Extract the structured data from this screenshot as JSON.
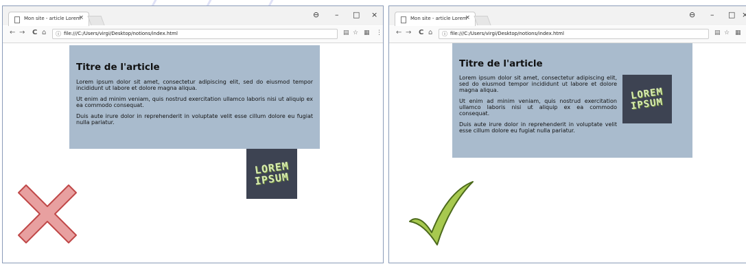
{
  "left_window": {
    "tab_title": "Mon site - article Lorem",
    "url": "file:///C:/Users/virgi/Desktop/notions/index.html",
    "article": {
      "title": "Titre de l'article",
      "paragraphs": [
        "Lorem ipsum dolor sit amet, consectetur adipiscing elit, sed do eiusmod tempor incididunt ut labore et dolore magna aliqua.",
        "Ut enim ad minim veniam, quis nostrud exercitation ullamco laboris nisi ut aliquip ex ea commodo consequat.",
        "Duis aute irure dolor in reprehenderit in voluptate velit esse cillum dolore eu fugiat nulla pariatur."
      ]
    },
    "logo": {
      "line1": "LOREM",
      "line2": "IPSUM"
    },
    "verdict_icon": "cross-icon"
  },
  "right_window": {
    "tab_title": "Mon site - article Lorem",
    "url": "file:///C:/Users/virgi/Desktop/notions/index.html",
    "article": {
      "title": "Titre de l'article",
      "paragraphs": [
        "Lorem ipsum dolor sit amet, consectetur adipiscing elit, sed do eiusmod tempor incididunt ut labore et dolore magna aliqua.",
        "Ut enim ad minim veniam, quis nostrud exercitation ullamco laboris nisi ut aliquip ex ea commodo consequat.",
        "Duis aute irure dolor in reprehenderit in voluptate velit esse cillum dolore eu fugiat nulla pariatur."
      ]
    },
    "logo": {
      "line1": "LOREM",
      "line2": "IPSUM"
    },
    "verdict_icon": "checkmark-icon"
  },
  "window_controls": {
    "account": "⊖",
    "minimize": "–",
    "maximize": "□",
    "close": "×",
    "tab_close": "×"
  },
  "nav_glyphs": {
    "back": "←",
    "forward": "→",
    "reload": "C",
    "home": "⌂",
    "info": "ⓘ",
    "translate": "▤",
    "bookmark": "☆",
    "extension": "▦",
    "menu": "⋮"
  },
  "colors": {
    "article_bg": "#a9bbcd",
    "logo_bg": "#3d4352",
    "logo_text": "#d8ecb0",
    "cross_fill": "#e8a0a0",
    "cross_stroke": "#c04848",
    "check_fill": "#a7c94f",
    "check_stroke": "#4c6a1c"
  }
}
